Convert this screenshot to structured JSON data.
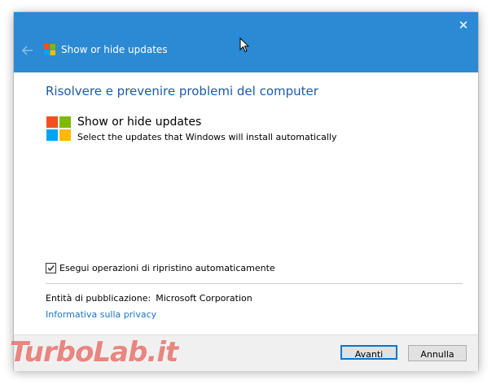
{
  "window": {
    "title": "Show or hide updates",
    "close_glyph": "✕"
  },
  "content": {
    "heading": "Risolvere e prevenire problemi del computer",
    "tool_name": "Show or hide updates",
    "tool_description": "Select the updates that Windows will install automatically",
    "checkbox_label": "Esegui operazioni di ripristino automaticamente",
    "checkbox_checked": true,
    "publisher_label": "Entità di pubblicazione:",
    "publisher_value": "Microsoft Corporation",
    "privacy_link": "Informativa sulla privacy"
  },
  "footer": {
    "next_label": "Avanti",
    "cancel_label": "Annulla"
  },
  "watermark": {
    "text": "TurboLab.it"
  },
  "colors": {
    "titlebar": "#2b8ad3",
    "heading": "#1d5aa8",
    "link": "#1a73c4",
    "logo_red": "#f25022",
    "logo_green": "#7fba00",
    "logo_blue": "#00a4ef",
    "logo_yellow": "#ffb900"
  },
  "icons": {
    "back": "back-arrow-icon",
    "close": "close-icon",
    "logo": "windows-logo-icon",
    "check": "checkmark-icon",
    "cursor": "mouse-cursor-icon"
  }
}
